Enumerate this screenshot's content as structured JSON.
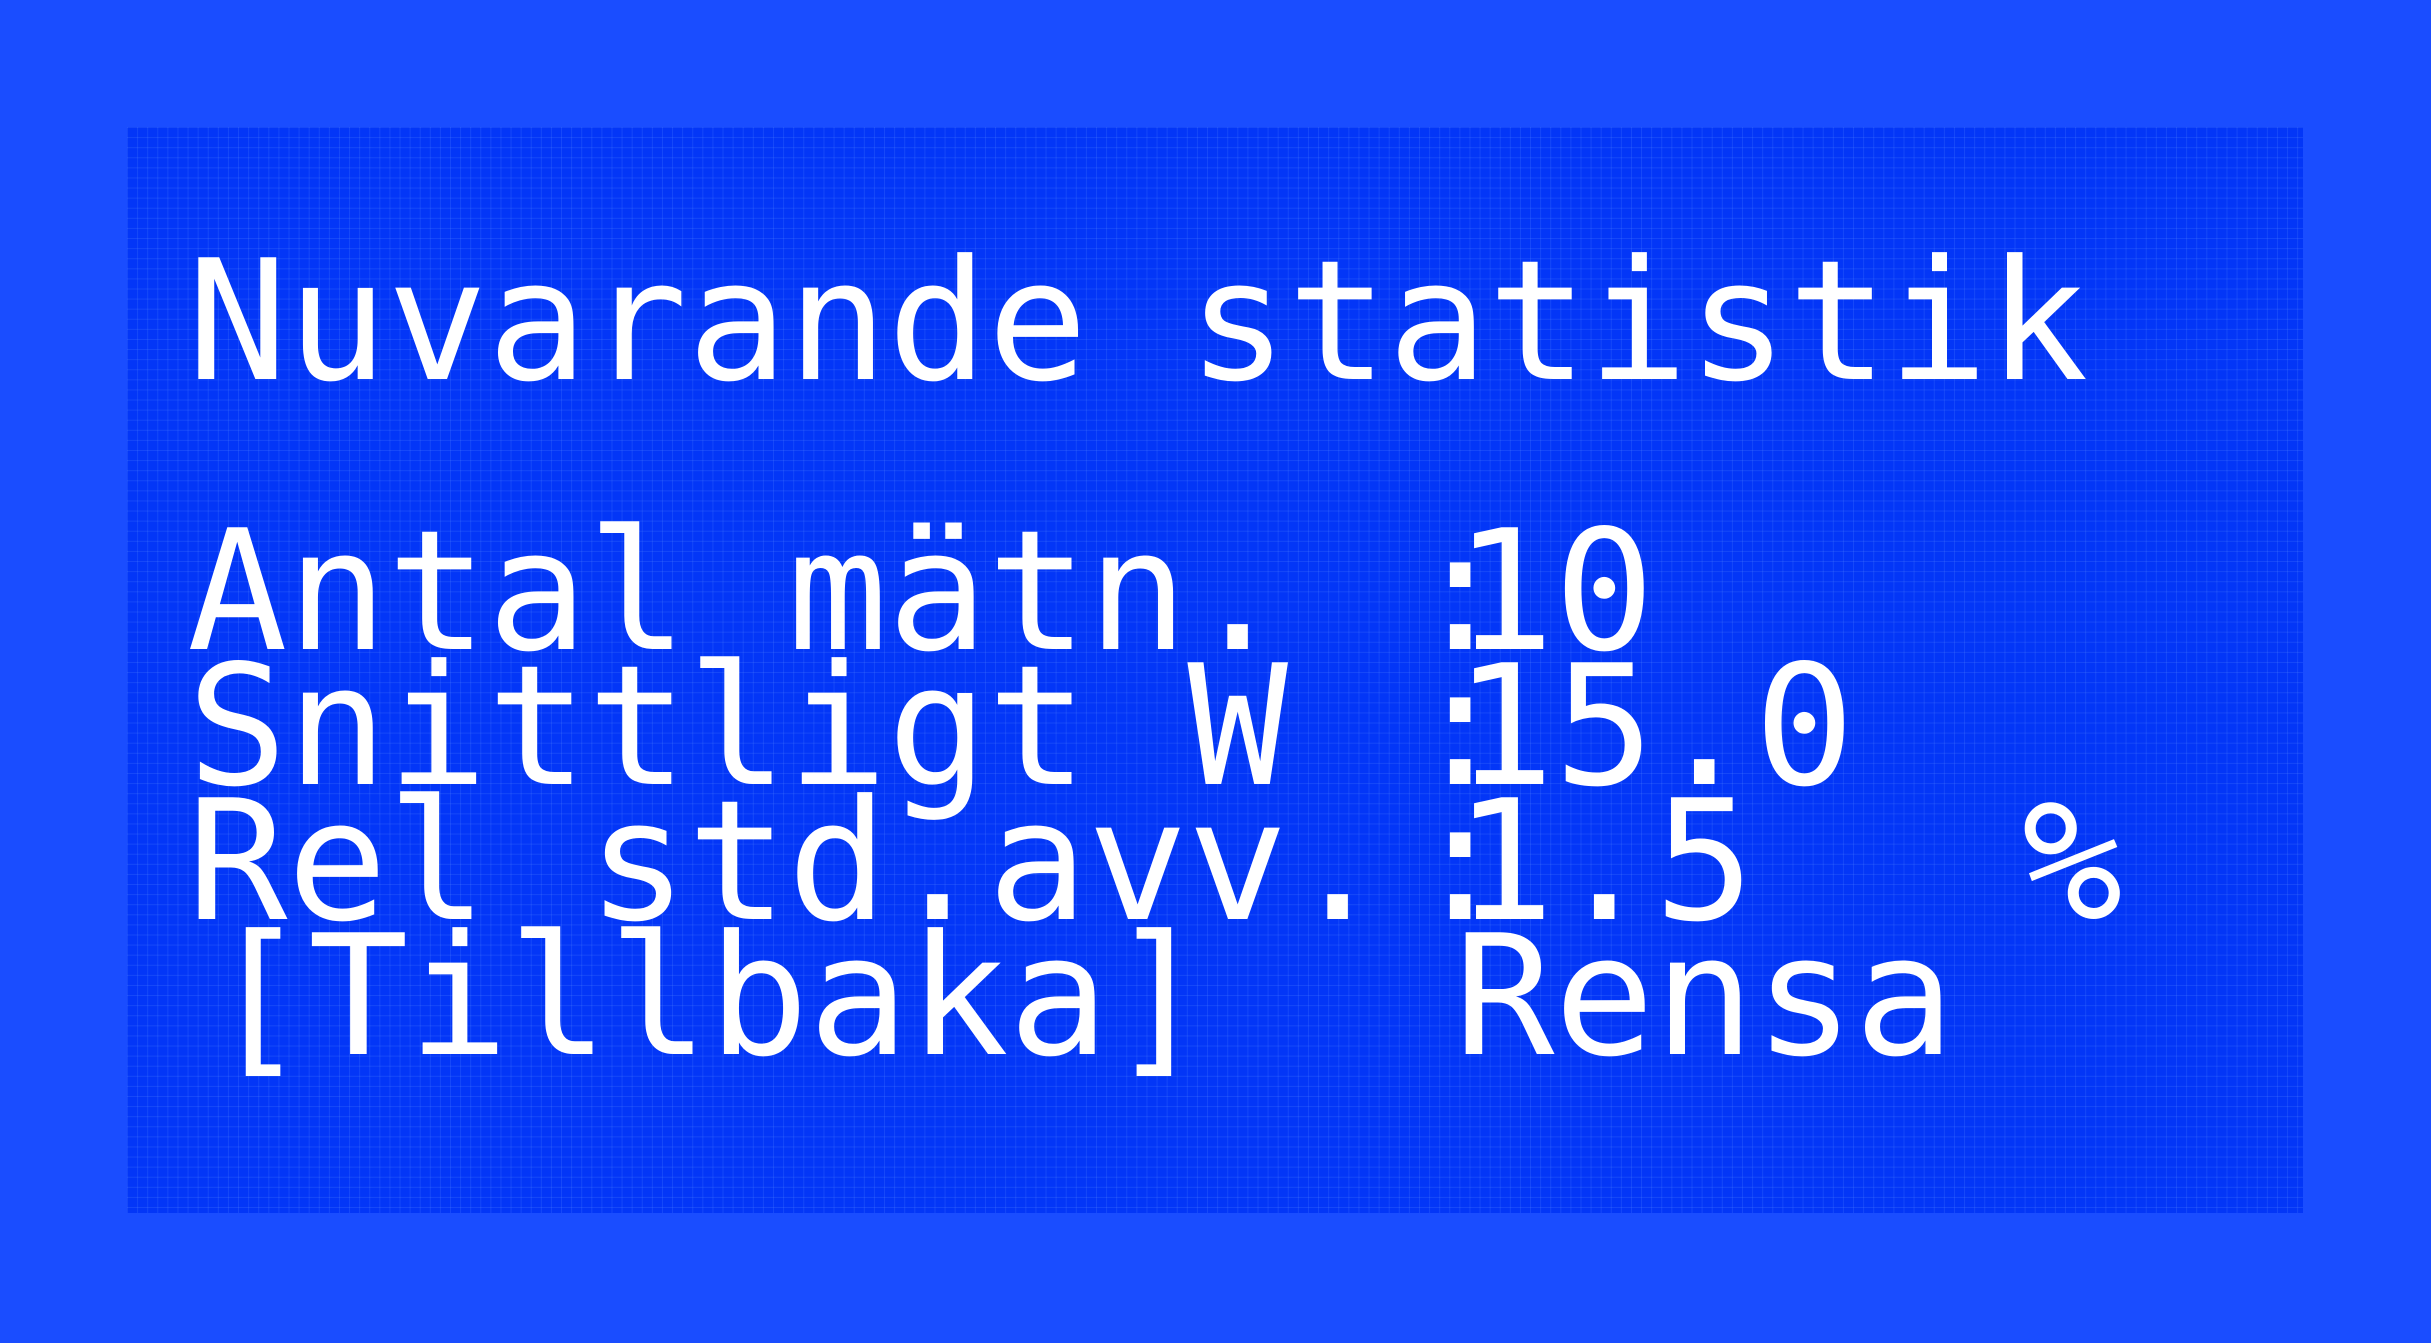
{
  "screen": {
    "title": "Nuvarande statistik",
    "rows": [
      {
        "label": "Antal mätn.",
        "value": "10",
        "unit": ""
      },
      {
        "label": "Snittligt W",
        "value": "15.0",
        "unit": ""
      },
      {
        "label": "Rel std.avv.",
        "value": "1.5",
        "unit": "%"
      }
    ],
    "separator": ":",
    "buttons": {
      "back": "[Tillbaka]",
      "clear": "Rensa"
    }
  },
  "colors": {
    "background": "#1a4dff",
    "lcd_panel": "#0336f7",
    "text": "#ffffff"
  }
}
